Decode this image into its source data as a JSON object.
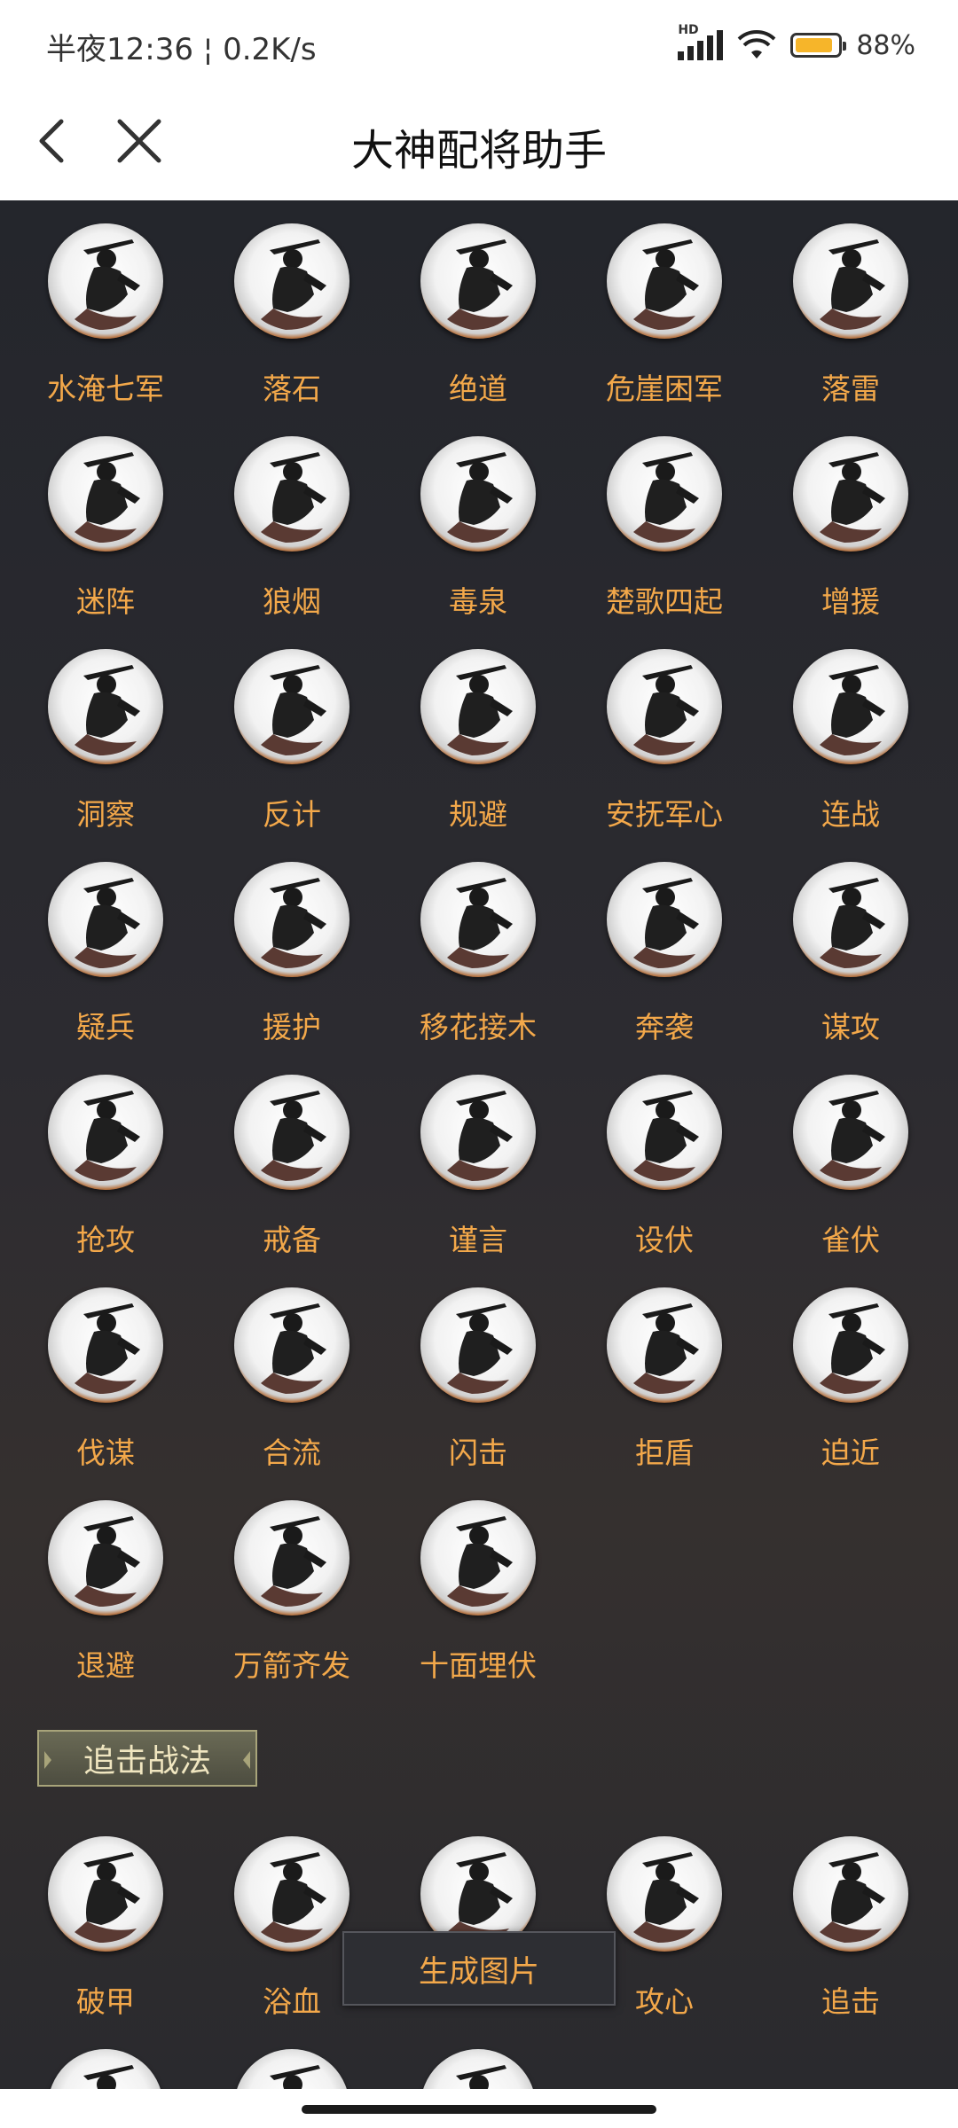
{
  "status_bar": {
    "time": "半夜12:36",
    "net_speed": "0.2K/s",
    "network_type": "HD",
    "battery_level": 88,
    "battery_text": "88%",
    "battery_color": "#f6b52a"
  },
  "header": {
    "title": "大神配将助手",
    "back_icon": "chevron-left-icon",
    "close_icon": "close-icon"
  },
  "skills": [
    {
      "label": "水淹七军"
    },
    {
      "label": "落石"
    },
    {
      "label": "绝道"
    },
    {
      "label": "危崖困军"
    },
    {
      "label": "落雷"
    },
    {
      "label": "迷阵"
    },
    {
      "label": "狼烟"
    },
    {
      "label": "毒泉"
    },
    {
      "label": "楚歌四起"
    },
    {
      "label": "增援"
    },
    {
      "label": "洞察"
    },
    {
      "label": "反计"
    },
    {
      "label": "规避"
    },
    {
      "label": "安抚军心"
    },
    {
      "label": "连战"
    },
    {
      "label": "疑兵"
    },
    {
      "label": "援护"
    },
    {
      "label": "移花接木"
    },
    {
      "label": "奔袭"
    },
    {
      "label": "谋攻"
    },
    {
      "label": "抢攻"
    },
    {
      "label": "戒备"
    },
    {
      "label": "谨言"
    },
    {
      "label": "设伏"
    },
    {
      "label": "雀伏"
    },
    {
      "label": "伐谋"
    },
    {
      "label": "合流"
    },
    {
      "label": "闪击"
    },
    {
      "label": "拒盾"
    },
    {
      "label": "迫近"
    },
    {
      "label": "退避"
    },
    {
      "label": "万箭齐发"
    },
    {
      "label": "十面埋伏"
    }
  ],
  "pursuit_section": {
    "title": "追击战法",
    "skills": [
      {
        "label": "破甲"
      },
      {
        "label": "浴血"
      },
      {
        "label": ""
      },
      {
        "label": "攻心"
      },
      {
        "label": "追击"
      },
      {
        "label": ""
      },
      {
        "label": ""
      },
      {
        "label": ""
      }
    ]
  },
  "generate_button": {
    "label": "生成图片"
  },
  "colors": {
    "skill_label": "#f3a84a",
    "content_bg": "#2a2a2e"
  }
}
